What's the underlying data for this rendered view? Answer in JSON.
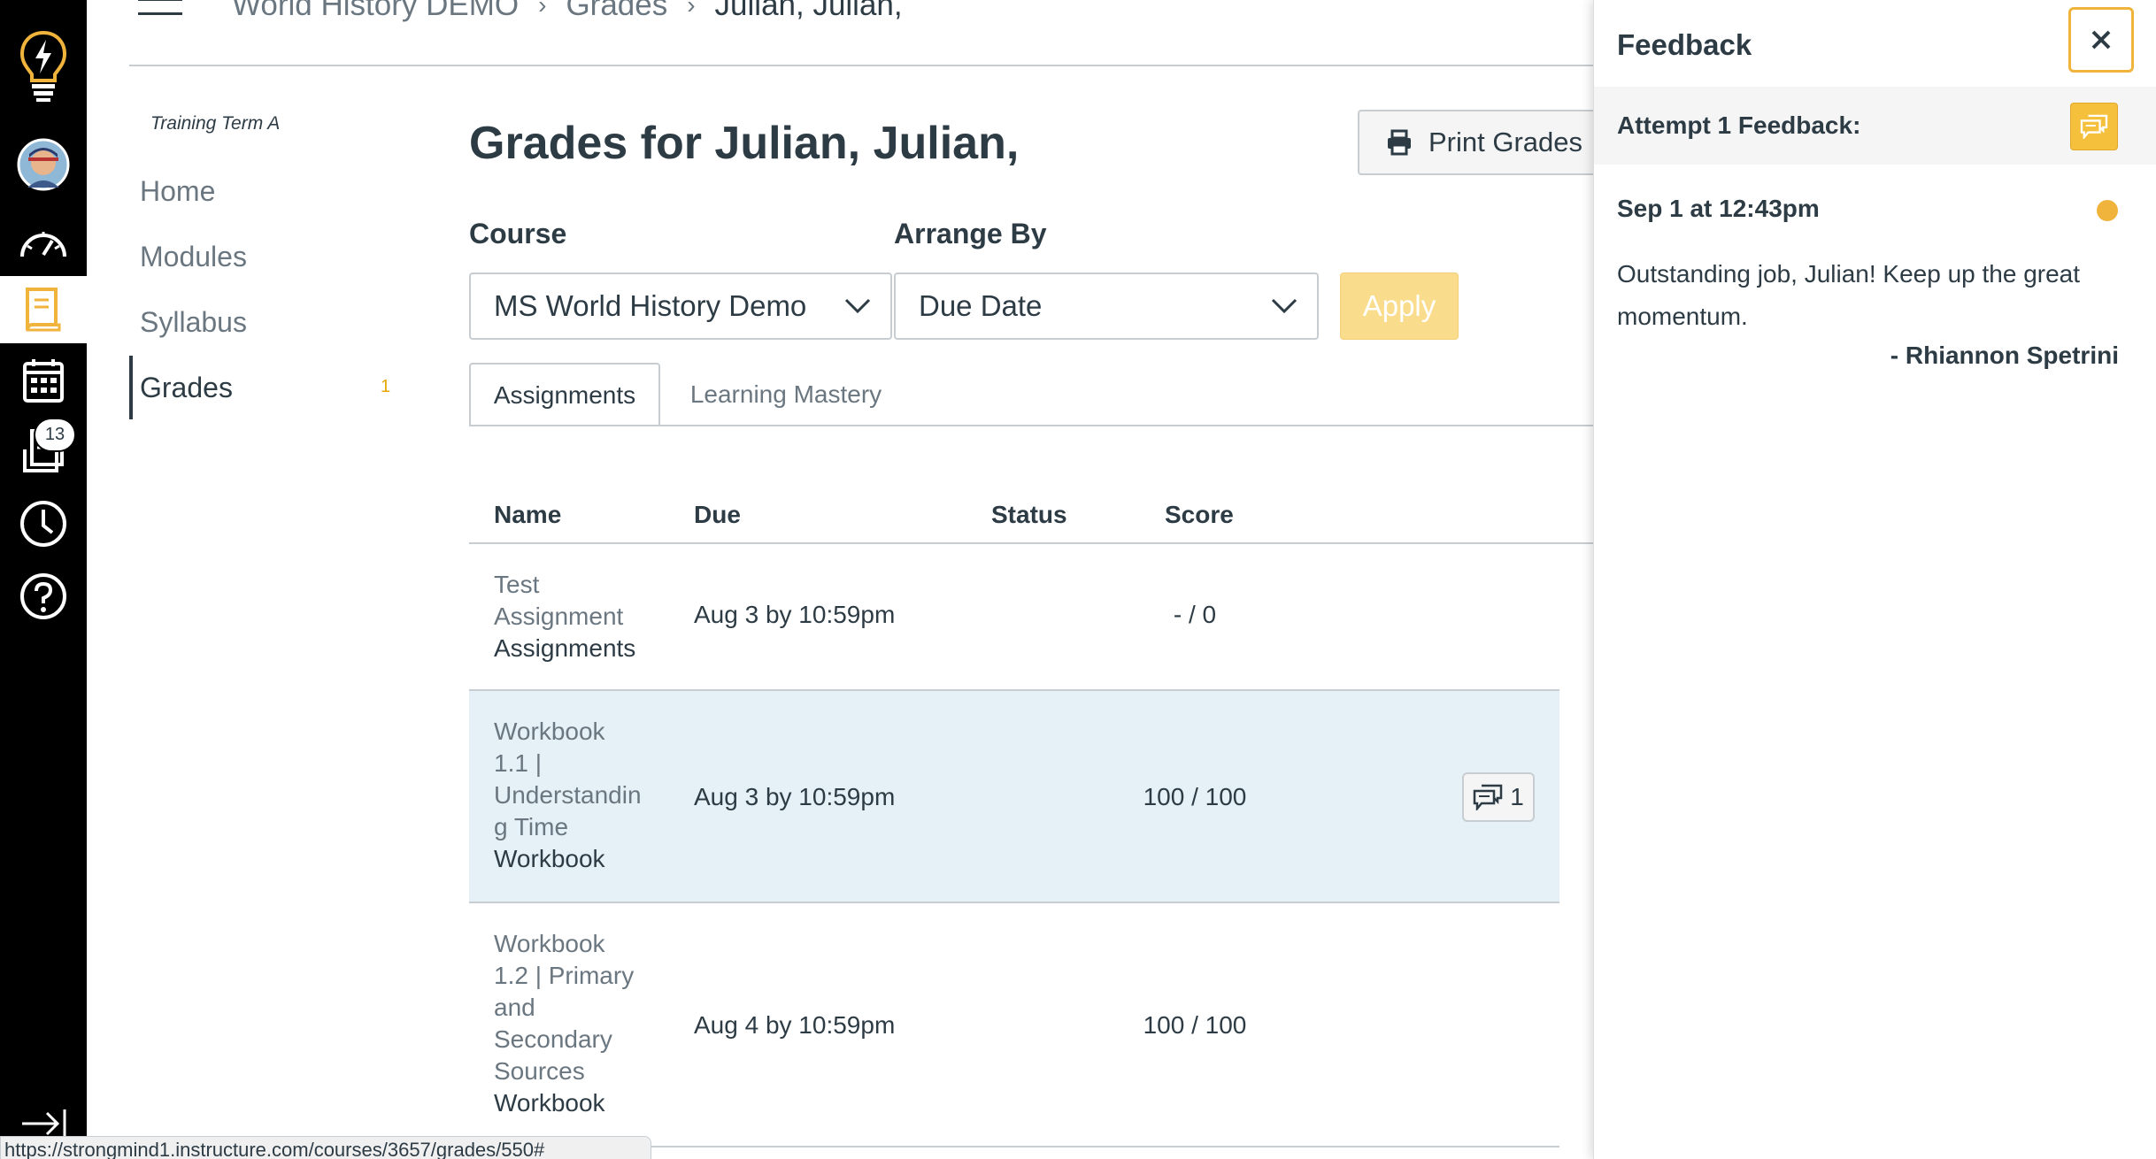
{
  "global_nav": {
    "inbox_badge": "13",
    "icons": [
      "lightbulb-logo-icon",
      "account-avatar",
      "dashboard-icon",
      "courses-icon",
      "calendar-icon",
      "inbox-icon",
      "history-icon",
      "help-icon",
      "collapse-nav-icon"
    ],
    "accent_color": "#f0b43c"
  },
  "breadcrumb": {
    "items": [
      "World History DEMO",
      "Grades",
      "Julian, Julian,"
    ]
  },
  "course_nav": {
    "term": "Training Term A",
    "items": [
      {
        "label": "Home"
      },
      {
        "label": "Modules"
      },
      {
        "label": "Syllabus"
      },
      {
        "label": "Grades",
        "count": "1"
      }
    ]
  },
  "main": {
    "title": "Grades for Julian, Julian,",
    "print_label": "Print Grades",
    "course_label": "Course",
    "course_value": "MS World History Demo",
    "arrange_label": "Arrange By",
    "arrange_value": "Due Date",
    "apply_label": "Apply",
    "tabs": [
      {
        "label": "Assignments",
        "active": true
      },
      {
        "label": "Learning Mastery",
        "active": false
      }
    ],
    "columns": [
      "Name",
      "Due",
      "Status",
      "Score"
    ],
    "rows": [
      {
        "name_lines": [
          "Test",
          "Assignment"
        ],
        "group": "Assignments",
        "due": "Aug 3 by 10:59pm",
        "status": "",
        "score": "- / 0"
      },
      {
        "name_lines": [
          "Workbook",
          "1.1 |",
          "Understandin",
          "g Time"
        ],
        "group": "Workbook",
        "due": "Aug 3 by 10:59pm",
        "status": "",
        "score": "100 / 100",
        "comments": "1"
      },
      {
        "name_lines": [
          "Workbook",
          "1.2 | Primary",
          "and",
          "Secondary",
          "Sources"
        ],
        "group": "Workbook",
        "due": "Aug 4 by 10:59pm",
        "status": "",
        "score": "100 / 100"
      }
    ]
  },
  "status_bar": {
    "url": "https://strongmind1.instructure.com/courses/3657/grades/550#"
  },
  "feedback_tray": {
    "title": "Feedback",
    "attempt_label": "Attempt 1 Feedback:",
    "comment_date": "Sep 1 at 12:43pm",
    "comment_text": "Outstanding job, Julian! Keep up the great momentum.",
    "comment_author": "- Rhiannon Spetrini"
  }
}
